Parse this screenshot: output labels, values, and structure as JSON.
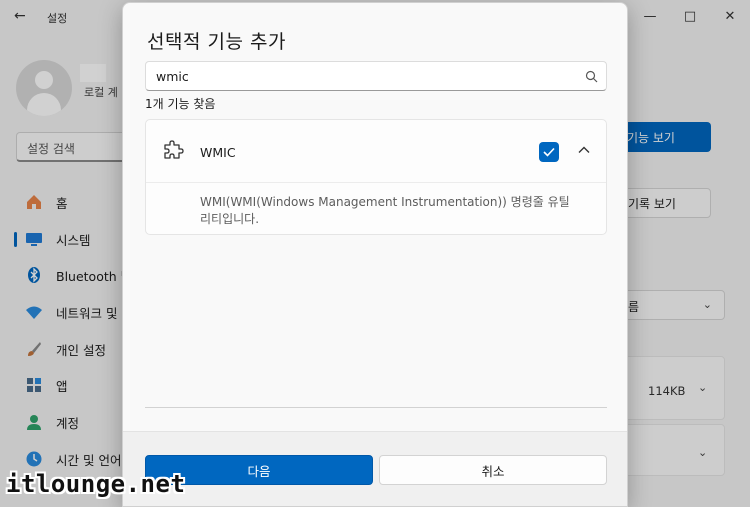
{
  "settings_window": {
    "title": "설정",
    "back_icon": "back-arrow-icon",
    "user_subtitle": "로컬 계",
    "search_placeholder": "설정 검색",
    "nav": [
      {
        "label": "홈",
        "icon": "home-icon",
        "color": "#e8844a"
      },
      {
        "label": "시스템",
        "icon": "monitor-icon",
        "color": "#1f7bd6",
        "active": true
      },
      {
        "label": "Bluetooth 및",
        "icon": "bluetooth-icon",
        "color": "#0067c0"
      },
      {
        "label": "네트워크 및",
        "icon": "wifi-icon",
        "color": "#2a8bdf"
      },
      {
        "label": "개인 설정",
        "icon": "brush-icon",
        "color": "#c4743c"
      },
      {
        "label": "앱",
        "icon": "apps-icon",
        "color": "#4a6c8c"
      },
      {
        "label": "계정",
        "icon": "account-icon",
        "color": "#2fa36b"
      },
      {
        "label": "시간 및 언어",
        "icon": "globe-clock-icon",
        "color": "#2a8bdf"
      }
    ],
    "right_buttons": {
      "view_features": "기능 보기",
      "view_history": "기록 보기",
      "sort_value": "름",
      "item_size": "114KB"
    }
  },
  "dialog": {
    "title": "선택적 기능 추가",
    "search_value": "wmic",
    "result_count": "1개 기능 찾음",
    "feature": {
      "name": "WMIC",
      "checked": true,
      "expanded": true,
      "description": "WMI(WMI(Windows Management Instrumentation)) 명령줄 유틸리티입니다."
    },
    "next_label": "다음",
    "cancel_label": "취소",
    "accent": "#0067c0"
  },
  "watermark": "itlounge.net"
}
